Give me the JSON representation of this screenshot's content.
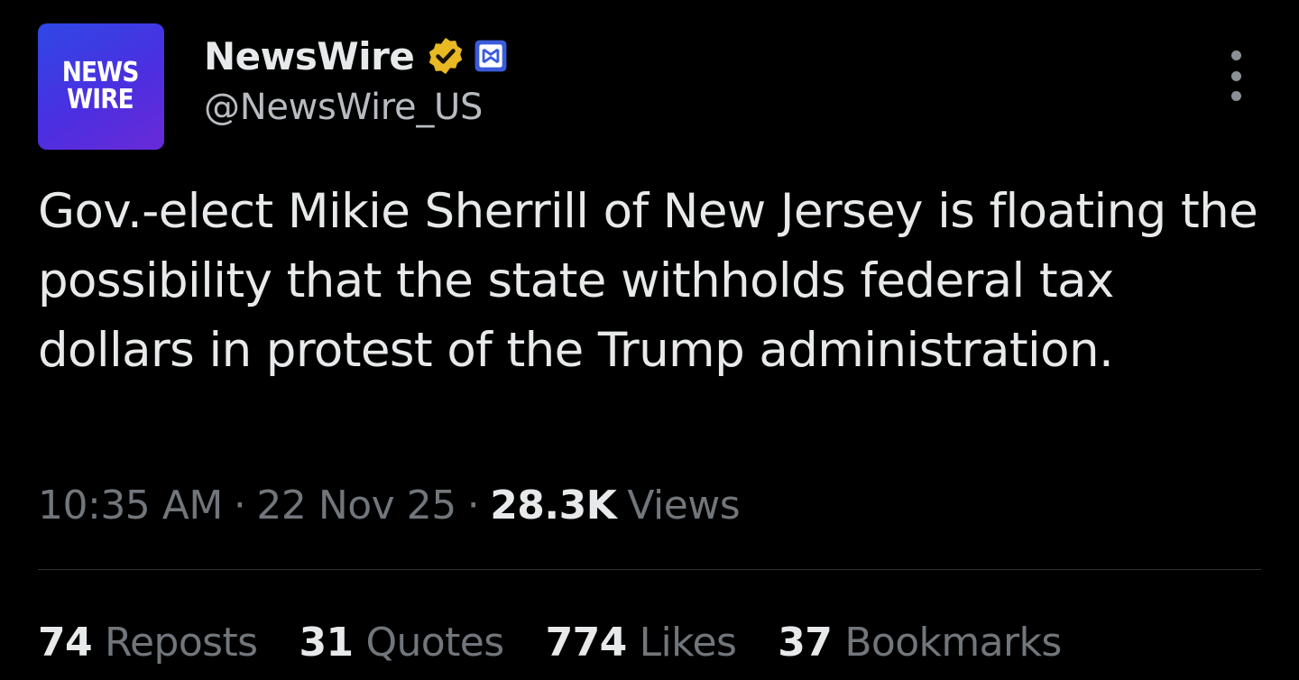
{
  "author": {
    "avatar_text_line1": "NEWS",
    "avatar_text_line2": "WIRE",
    "display_name": "NewsWire",
    "handle": "@NewsWire_US",
    "verified_icon": "verified-gold-badge-icon",
    "affiliate_icon": "affiliate-badge-icon"
  },
  "tweet": {
    "text": "Gov.-elect Mikie Sherrill of New Jersey is floating the possibility that the state withholds federal tax dollars in protest of the Trump administration.",
    "time": "10:35 AM",
    "separator": "·",
    "date": "22 Nov 25",
    "views_count": "28.3K",
    "views_label": "Views"
  },
  "stats": [
    {
      "count": "74",
      "label": "Reposts"
    },
    {
      "count": "31",
      "label": "Quotes"
    },
    {
      "count": "774",
      "label": "Likes"
    },
    {
      "count": "37",
      "label": "Bookmarks"
    }
  ],
  "colors": {
    "background": "#000000",
    "primary_text": "#e7e9ea",
    "secondary_text": "#71767b",
    "verified_gold": "#e8b923",
    "affiliate_blue": "#3b5bdb",
    "avatar_blue": "#3a3ee6"
  }
}
